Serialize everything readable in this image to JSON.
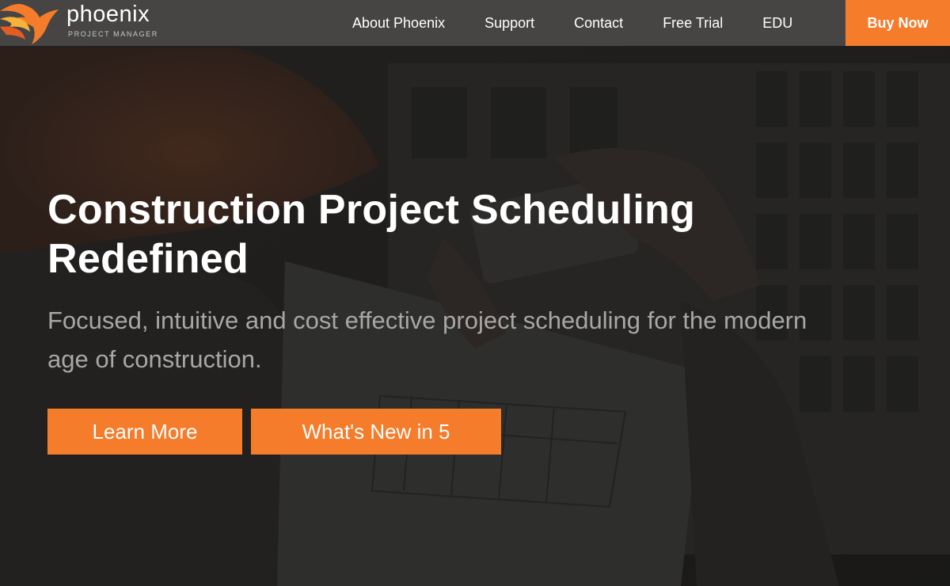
{
  "brand": {
    "name": "phoenix",
    "tagline": "PROJECT MANAGER",
    "logo_icon": "phoenix-bird-icon"
  },
  "nav": {
    "items": [
      {
        "label": "About Phoenix"
      },
      {
        "label": "Support"
      },
      {
        "label": "Contact"
      },
      {
        "label": "Free Trial"
      },
      {
        "label": "EDU"
      }
    ],
    "buy_now": "Buy Now"
  },
  "hero": {
    "title": "Construction Project Scheduling Redefined",
    "subtitle": "Focused, intuitive and cost effective project scheduling for the modern age of construction.",
    "buttons": {
      "learn_more": "Learn More",
      "whats_new": "What's New in 5"
    }
  },
  "colors": {
    "accent": "#f47c2b",
    "navbar": "#464544",
    "hero_overlay": "#1f1d1c",
    "title_text": "#ffffff",
    "subtitle_text": "#a9a7a5"
  }
}
